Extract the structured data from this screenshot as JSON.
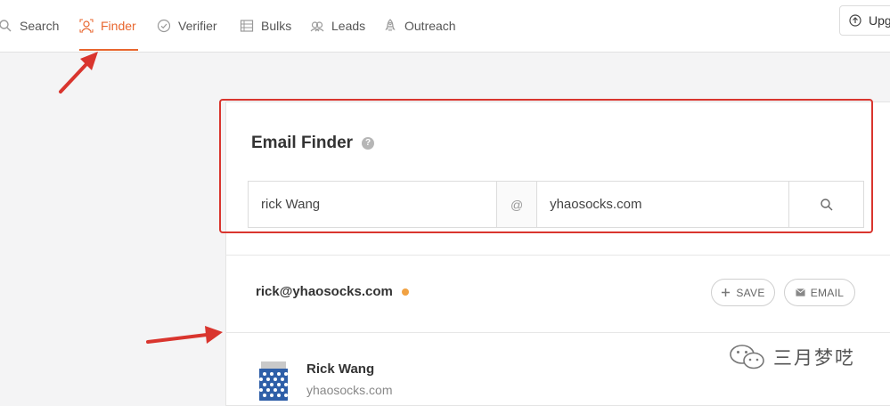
{
  "nav": {
    "items": [
      {
        "label": "Search",
        "icon": "search-icon"
      },
      {
        "label": "Finder",
        "icon": "finder-icon",
        "active": true
      },
      {
        "label": "Verifier",
        "icon": "check-circle-icon"
      },
      {
        "label": "Bulks",
        "icon": "list-icon"
      },
      {
        "label": "Leads",
        "icon": "users-icon"
      },
      {
        "label": "Outreach",
        "icon": "rocket-icon"
      }
    ],
    "upgrade_label": "Upg"
  },
  "finder": {
    "title": "Email Finder",
    "help": "?",
    "name_value": "rick Wang",
    "at_symbol": "@",
    "domain_value": "yhaosocks.com"
  },
  "result": {
    "email": "rick@yhaosocks.com",
    "save_label": "SAVE",
    "email_label": "EMAIL",
    "person_name": "Rick Wang",
    "person_domain": "yhaosocks.com"
  },
  "watermark": {
    "text": "三月梦呓"
  },
  "colors": {
    "accent": "#e8662e",
    "highlight": "#d9352e",
    "status_dot": "#f1a243"
  }
}
